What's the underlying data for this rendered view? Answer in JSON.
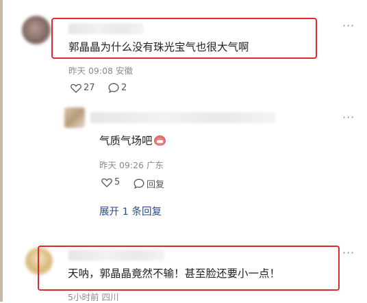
{
  "comments": [
    {
      "text": "郭晶晶为什么没有珠光宝气也很大气啊",
      "time": "昨天 09:08",
      "location": "安徽",
      "likes": "27",
      "replies": "2"
    },
    {
      "text": "气质气场吧",
      "time": "昨天 09:26",
      "location": "广东",
      "likes": "5",
      "reply_label": "回复",
      "expand_label": "展开 1 条回复"
    },
    {
      "text": "天呐，郭晶晶竟然不输！甚至脸还要小一点！",
      "time": "5小时前",
      "location": "四川"
    }
  ],
  "more_label": "···",
  "colors": {
    "highlight": "#e0282e",
    "link": "#2a4a8a",
    "muted": "#8a8a8a"
  }
}
